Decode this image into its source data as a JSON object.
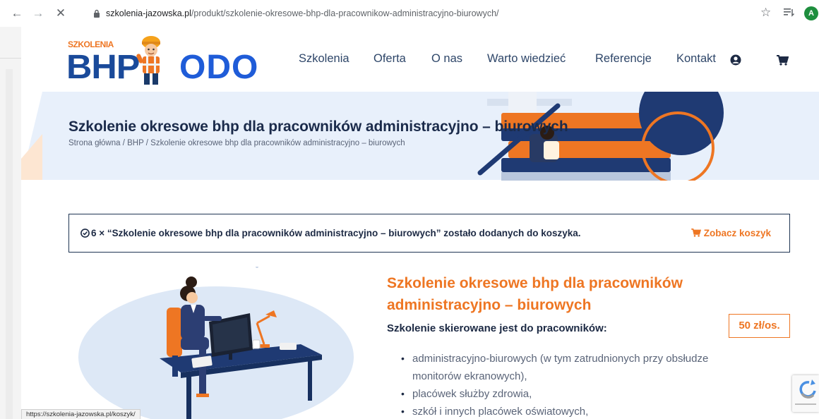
{
  "browser": {
    "url_host": "szkolenia-jazowska.pl",
    "url_path": "/produkt/szkolenie-okresowe-bhp-dla-pracownikow-administracyjno-biurowych/",
    "profile_initial": "A",
    "status_url": "https://szkolenia-jazowska.pl/koszyk/"
  },
  "logo": {
    "small_text": "SZKOLENIA",
    "bhp_text": "BHP",
    "odo_text": "ODO"
  },
  "menu": {
    "items": [
      "Szkolenia",
      "Oferta",
      "O nas",
      "Warto wiedzieć",
      "Referencje",
      "Kontakt"
    ]
  },
  "hero": {
    "title": "Szkolenie okresowe bhp dla pracowników administracyjno – biurowych",
    "breadcrumb": [
      "Strona główna",
      "BHP",
      "Szkolenie okresowe bhp dla pracowników administracyjno – biurowych"
    ],
    "breadcrumb_separator": " / "
  },
  "notice": {
    "text": "6 × “Szkolenie okresowe bhp dla pracowników administracyjno – biurowych” zostało dodanych do koszyka.",
    "link_label": "Zobacz koszyk"
  },
  "product": {
    "title": "Szkolenie okresowe bhp dla pracowników administracyjno – biurowych",
    "subtitle": "Szkolenie skierowane jest do pracowników:",
    "price": "50 zł/os.",
    "audience": [
      "administracyjno-biurowych (w tym zatrudnionych przy obsłudze monitorów ekranowych),",
      "placówek służby zdrowia,",
      "szkół i innych placówek oświatowych,"
    ]
  },
  "colors": {
    "accent": "#ee7623",
    "navy": "#1d2a44",
    "brand_blue": "#1f5cd8"
  }
}
